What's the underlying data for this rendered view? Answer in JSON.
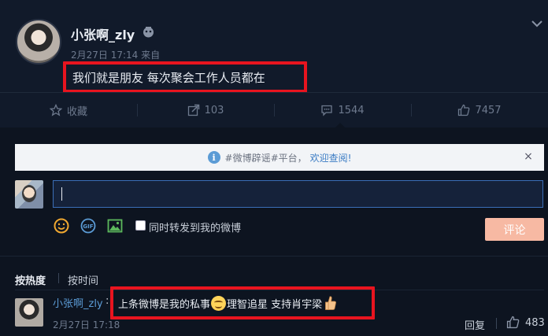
{
  "post": {
    "author": "小张啊_zly",
    "meta": "2月27日 17:14 来自",
    "text": "我们就是朋友 每次聚会工作人员都在"
  },
  "actions": [
    {
      "name": "favorite",
      "label": "收藏",
      "icon": "star-icon"
    },
    {
      "name": "repost",
      "label": "103",
      "icon": "share-icon"
    },
    {
      "name": "comment",
      "label": "1544",
      "icon": "comment-icon"
    },
    {
      "name": "like",
      "label": "7457",
      "icon": "thumbs-up-icon"
    }
  ],
  "notice": {
    "tag": "#微博辟谣#平台，",
    "link": "欢迎查阅!",
    "close": "×"
  },
  "composer": {
    "placeholder": "",
    "repost_label": "同时转发到我的微博",
    "submit_label": "评论"
  },
  "sort": {
    "hot": "按热度",
    "time": "按时间"
  },
  "comments": [
    {
      "author": "小张啊_zly",
      "colon": ":",
      "text_part1": "上条微博是我的私事",
      "text_part2": "理智追星 支持肖宇梁",
      "time": "2月27日 17:18",
      "reply_label": "回复",
      "likes": "483"
    }
  ],
  "colors": {
    "background": "#111a2a",
    "panel": "#0d1420",
    "highlight": "#e8141f",
    "link": "#5b9bd5",
    "submit": "#f7b9a3"
  }
}
